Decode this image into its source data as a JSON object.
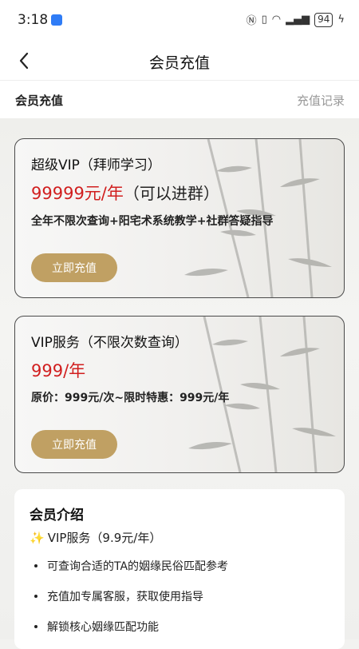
{
  "status_bar": {
    "time": "3:18",
    "battery": "94"
  },
  "header": {
    "title": "会员充值"
  },
  "section": {
    "title": "会员充值",
    "history_link": "充值记录"
  },
  "plans": [
    {
      "title": "超级VIP（拜师学习）",
      "price": "99999元/年",
      "price_note": "（可以进群）",
      "description": "全年不限次查询+阳宅术系统教学+社群答疑指导",
      "button_label": "立即充值"
    },
    {
      "title": "VIP服务（不限次数查询）",
      "price": "999/年",
      "description": "原价：999元/次~限时特惠：999元/年",
      "button_label": "立即充值"
    }
  ],
  "intro": {
    "title": "会员介绍",
    "subtitle": "VIP服务（9.9元/年）",
    "items": [
      "可查询合适的TA的姻缘民俗匹配参考",
      "充值加专属客服，获取使用指导",
      "解锁核心姻缘匹配功能"
    ]
  },
  "colors": {
    "accent_gold": "#c0a063",
    "price_red": "#d11f1f"
  },
  "icons": {
    "back": "back-arrow-icon",
    "sparkle": "sparkle-icon"
  }
}
